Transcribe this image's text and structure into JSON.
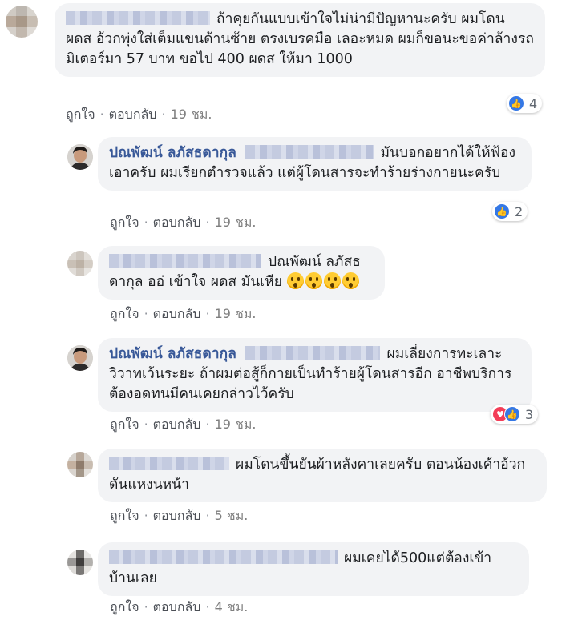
{
  "comments": [
    {
      "author": "",
      "text": "ถ้าคุยกันแบบเข้าใจไม่น่ามีปัญหานะครับ ผมโดน ผดส อ้วกพุ่งใส่เต็มแขนด้านซ้าย ตรงเบรคมือ เลอะหมด ผมก็ขอนะขอค่าล้างรถ มิเตอร์มา 57 บาท ขอไป 400 ผดส ให้มา 1000",
      "like_label": "ถูกใจ",
      "reply_label": "ตอบกลับ",
      "time": "19 ชม.",
      "reaction_count": "4"
    },
    {
      "author": "ปณพัฒน์ ลภัสธดากุล",
      "text": "มันบอกอยากได้ให้ฟ้องเอาครับ ผมเรียกตำรวจแล้ว แต่ผู้โดนสารจะทำร้ายร่างกายนะครับ",
      "like_label": "ถูกใจ",
      "reply_label": "ตอบกลับ",
      "time": "19 ชม.",
      "reaction_count": "2"
    },
    {
      "author": "",
      "mention": "ปณพัฒน์ ลภัสธดากุล",
      "text": "ออ่ เข้าใจ ผดส มันเหีย",
      "like_label": "ถูกใจ",
      "reply_label": "ตอบกลับ",
      "time": "19 ชม."
    },
    {
      "author": "ปณพัฒน์ ลภัสธดากุล",
      "text": "ผมเลี่ยงการทะเลาะวิวาทเว้นระยะ ถ้าผมต่อสู้ก็กายเป็นทำร้ายผู้โดนสารอีก อาชีพบริการต้องอดทนมีคนเคยกล่าวไว้ครับ",
      "like_label": "ถูกใจ",
      "reply_label": "ตอบกลับ",
      "time": "19 ชม.",
      "reaction_count": "3"
    },
    {
      "author": "",
      "text": "ผมโดนขึ้นยันผ้าหลังคาเลยครับ ตอนน้องเค้าอ้วกดันแหงนหน้า",
      "like_label": "ถูกใจ",
      "reply_label": "ตอบกลับ",
      "time": "5 ชม."
    },
    {
      "author": "",
      "text": "ผมเคยได้500แต่ต้องเข้าบ้านเลย",
      "like_label": "ถูกใจ",
      "reply_label": "ตอบกลับ",
      "time": "4 ชม."
    }
  ],
  "icons": {
    "like": "thumbs-up-icon",
    "love": "heart-icon",
    "surprised": "surprised-emoji-icon"
  },
  "colors": {
    "bubble": "#f2f3f5",
    "name": "#385898",
    "like": "#3578e5",
    "love": "#f33e58"
  }
}
